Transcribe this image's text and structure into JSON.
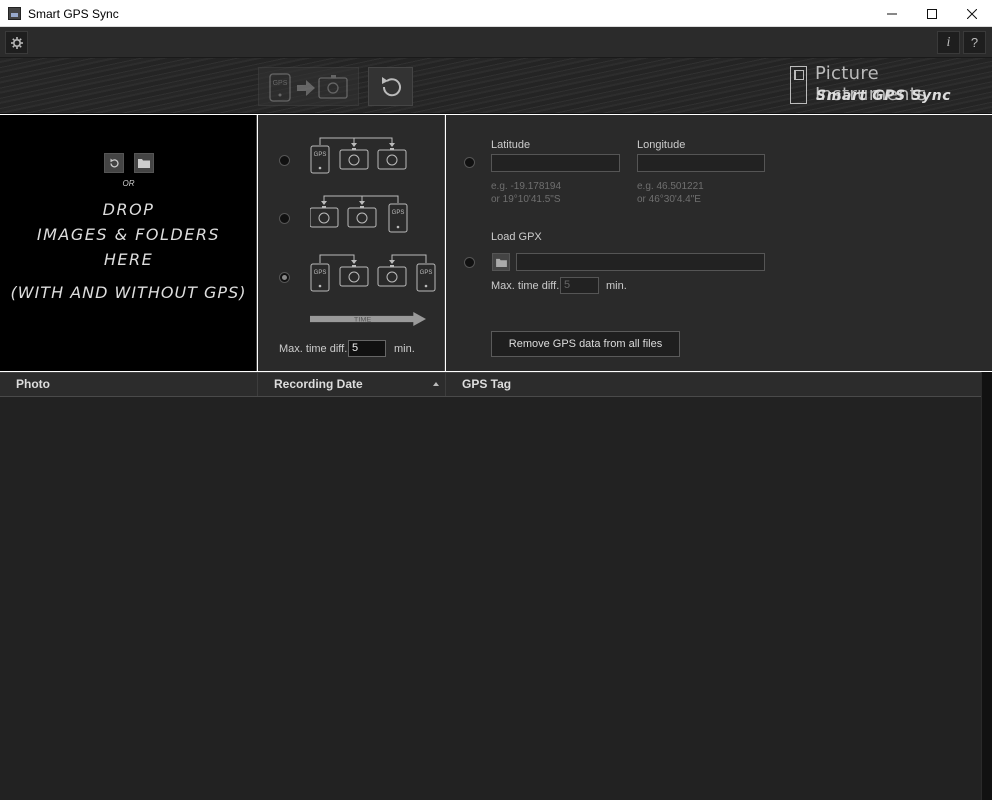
{
  "window": {
    "title": "Smart GPS Sync"
  },
  "toolbar": {
    "settings_icon": "gear-icon",
    "info_label": "i",
    "help_label": "?"
  },
  "banner": {
    "brand_name": "Picture Instruments",
    "product_name": "Smart GPS Sync"
  },
  "dropzone": {
    "or_label": "OR",
    "drop_line1": "DROP",
    "drop_line2": "IMAGES & FOLDERS",
    "drop_line3": "HERE",
    "note": "(WITH AND WITHOUT GPS)"
  },
  "modes": {
    "options": [
      {
        "name": "gps-first",
        "checked": false
      },
      {
        "name": "gps-last",
        "checked": false
      },
      {
        "name": "gps-interleaved",
        "checked": true
      }
    ],
    "gps_label": "GPS",
    "timeline_label": "TIME",
    "max_time_label": "Max. time diff.",
    "max_time_value": "5",
    "max_time_unit": "min."
  },
  "coords": {
    "latitude_label": "Latitude",
    "longitude_label": "Longitude",
    "latitude_hint1": "e.g. -19.178194",
    "latitude_hint2": "or 19°10'41.5\"S",
    "longitude_hint1": "e.g. 46.501221",
    "longitude_hint2": "or 46°30'4.4\"E"
  },
  "gpx": {
    "label": "Load GPX",
    "max_time_label": "Max. time diff.",
    "max_time_value": "5",
    "max_time_unit": "min."
  },
  "actions": {
    "remove_label": "Remove GPS data from all files"
  },
  "table": {
    "columns": [
      "Photo",
      "Recording Date",
      "GPS Tag"
    ],
    "sort_column": "Recording Date",
    "sort_direction": "ascending",
    "rows": []
  }
}
